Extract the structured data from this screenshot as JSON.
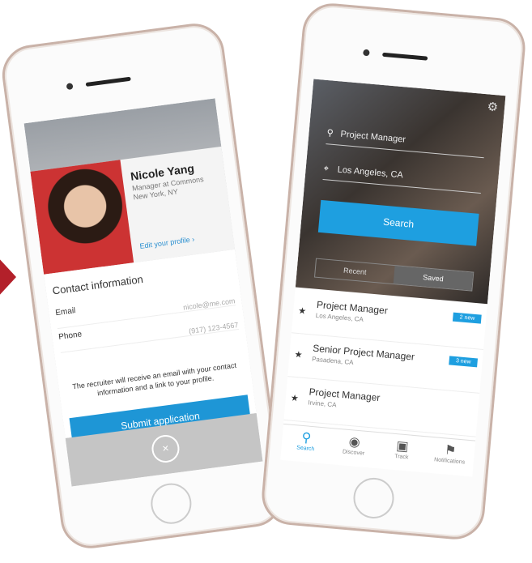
{
  "profile": {
    "name": "Nicole Yang",
    "title": "Manager at Commons",
    "location": "New York, NY",
    "edit_link": "Edit your profile",
    "contact_heading": "Contact information",
    "email_label": "Email",
    "email_value": "nicole@me.com",
    "phone_label": "Phone",
    "phone_value": "(917) 123-4567",
    "note": "The recruiter will receive an email with your contact information and a link to your profile.",
    "submit_label": "Submit application",
    "close_glyph": "×"
  },
  "search": {
    "keyword": "Project Manager",
    "location": "Los Angeles, CA",
    "button_label": "Search",
    "seg_recent": "Recent",
    "seg_saved": "Saved"
  },
  "jobs": [
    {
      "title": "Project Manager",
      "location": "Los Angeles, CA",
      "badge": "2 new"
    },
    {
      "title": "Senior Project Manager",
      "location": "Pasadena, CA",
      "badge": "3 new"
    },
    {
      "title": "Project Manager",
      "location": "Irvine, CA",
      "badge": ""
    }
  ],
  "tabs": [
    {
      "label": "Search",
      "icon": "search-icon"
    },
    {
      "label": "Discover",
      "icon": "compass-icon"
    },
    {
      "label": "Track",
      "icon": "briefcase-icon"
    },
    {
      "label": "Notifications",
      "icon": "flag-icon"
    }
  ],
  "colors": {
    "accent": "#1e9fe0",
    "arrow": "#b3202a"
  }
}
